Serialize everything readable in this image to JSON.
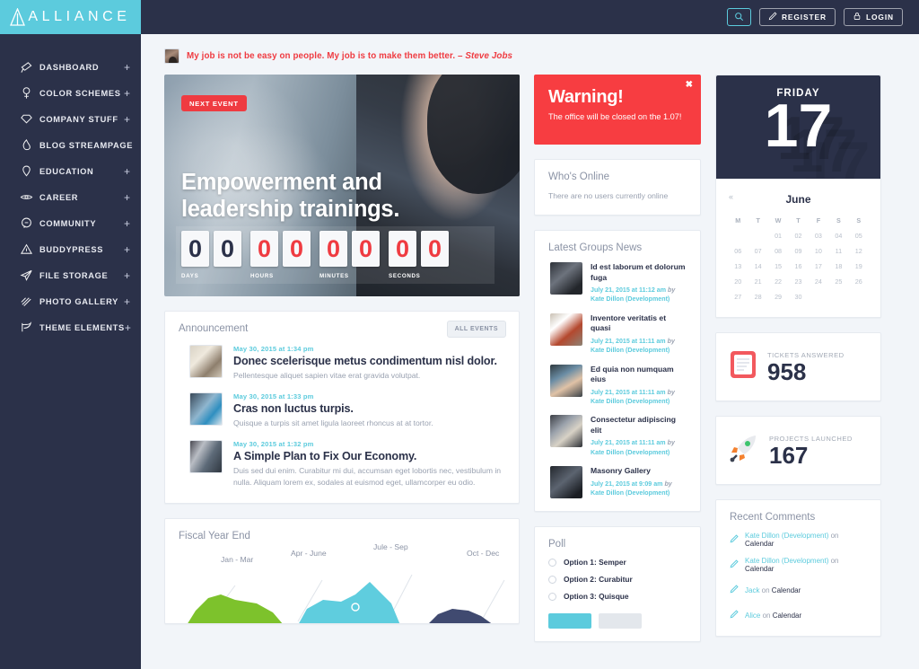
{
  "brand": {
    "name": "ALLIANCE",
    "logo_icon": "triangle-a-icon",
    "accent": "#5ccbdd",
    "dark": "#2b3149",
    "red": "#ef3b41"
  },
  "sidebar": {
    "items": [
      {
        "label": "DASHBOARD",
        "icon": "megaphone-icon",
        "expand": "+"
      },
      {
        "label": "COLOR SCHEMES",
        "icon": "palette-icon",
        "expand": "+"
      },
      {
        "label": "COMPANY STUFF",
        "icon": "diamond-icon",
        "expand": "+"
      },
      {
        "label": "BLOG STREAMPAGE",
        "icon": "flame-icon",
        "expand": ""
      },
      {
        "label": "EDUCATION",
        "icon": "pin-icon",
        "expand": "+"
      },
      {
        "label": "CAREER",
        "icon": "eye-icon",
        "expand": "+"
      },
      {
        "label": "COMMUNITY",
        "icon": "chat-icon",
        "expand": "+"
      },
      {
        "label": "BUDDYPRESS",
        "icon": "triangle-icon",
        "expand": "+"
      },
      {
        "label": "FILE STORAGE",
        "icon": "paper-plane-icon",
        "expand": "+"
      },
      {
        "label": "PHOTO GALLERY",
        "icon": "sparkle-icon",
        "expand": "+"
      },
      {
        "label": "THEME ELEMENTS",
        "icon": "bird-icon",
        "expand": "+"
      }
    ]
  },
  "topbar": {
    "search_icon": "search-icon",
    "register_label": "REGISTER",
    "register_icon": "pencil-icon",
    "login_label": "LOGIN",
    "login_icon": "lock-icon"
  },
  "quote": {
    "text": "My job is not be easy on people. My job is to make them better. – ",
    "author": "Steve Jobs",
    "avatar": "user-avatar"
  },
  "hero": {
    "badge": "NEXT EVENT",
    "title_line1": "Empowerment and",
    "title_line2": "leadership trainings.",
    "countdown": [
      {
        "label": "DAYS",
        "digits": [
          "0",
          "0"
        ],
        "color": "navy"
      },
      {
        "label": "HOURS",
        "digits": [
          "0",
          "0"
        ],
        "color": "red"
      },
      {
        "label": "MINUTES",
        "digits": [
          "0",
          "0"
        ],
        "color": "red"
      },
      {
        "label": "SECONDS",
        "digits": [
          "0",
          "0"
        ],
        "color": "red"
      }
    ]
  },
  "announcement": {
    "title": "Announcement",
    "all_events_label": "ALL EVENTS",
    "items": [
      {
        "date": "May 30, 2015 at 1:34 pm",
        "heading": "Donec scelerisque metus condimentum nisl dolor.",
        "excerpt": "Pellentesque aliquet sapien vitae erat gravida volutpat."
      },
      {
        "date": "May 30, 2015 at 1:33 pm",
        "heading": "Cras non luctus turpis.",
        "excerpt": "Quisque a turpis sit amet ligula laoreet rhoncus at at tortor."
      },
      {
        "date": "May 30, 2015 at 1:32 pm",
        "heading": "A Simple Plan to Fix Our Economy.",
        "excerpt": "Duis sed dui enim. Curabitur mi dui, accumsan eget lobortis nec, vestibulum in nulla. Aliquam lorem ex, sodales at euismod eget, ullamcorper eu odio."
      }
    ]
  },
  "alert": {
    "heading": "Warning!",
    "text": "The office will be closed on the 1.07!",
    "close_icon": "close-icon",
    "color": "#f73d41"
  },
  "whos_online": {
    "title": "Who's Online",
    "empty": "There are no users currently online"
  },
  "groups_news": {
    "title": "Latest Groups News",
    "items": [
      {
        "title": "Id est laborum et dolorum fuga",
        "date": "July 21, 2015 at 11:12 am",
        "by": "by ",
        "author": "Kate Dillon (Development)"
      },
      {
        "title": "Inventore veritatis et quasi",
        "date": "July 21, 2015 at 11:11 am",
        "by": "by ",
        "author": "Kate Dillon (Development)"
      },
      {
        "title": "Ed quia non numquam eius",
        "date": "July 21, 2015 at 11:11 am",
        "by": "by ",
        "author": "Kate Dillon (Development)"
      },
      {
        "title": "Consectetur adipiscing elit",
        "date": "July 21, 2015 at 11:11 am",
        "by": "by ",
        "author": "Kate Dillon (Development)"
      },
      {
        "title": "Masonry Gallery",
        "date": "July 21, 2015 at 9:09 am",
        "by": "by ",
        "author": "Kate Dillon (Development)"
      }
    ]
  },
  "poll": {
    "title": "Poll",
    "options": [
      "Option 1: Semper",
      "Option 2: Curabitur",
      "Option 3: Quisque"
    ],
    "vote_label": "",
    "results_label": ""
  },
  "calendar": {
    "day_name": "FRIDAY",
    "day_number": "17",
    "month": "June",
    "prev_icon": "chevron-left-icon",
    "dow": [
      "M",
      "T",
      "W",
      "T",
      "F",
      "S",
      "S"
    ],
    "blanks_before": 2,
    "days": [
      "01",
      "02",
      "03",
      "04",
      "05",
      "06",
      "07",
      "08",
      "09",
      "10",
      "11",
      "12",
      "13",
      "14",
      "15",
      "16",
      "17",
      "18",
      "19",
      "20",
      "21",
      "22",
      "23",
      "24",
      "25",
      "26",
      "27",
      "28",
      "29",
      "30"
    ]
  },
  "stats": [
    {
      "label": "TICKETS ANSWERED",
      "value": "958",
      "icon": "notepad-icon"
    },
    {
      "label": "PROJECTS LAUNCHED",
      "value": "167",
      "icon": "rocket-icon"
    }
  ],
  "recent_comments": {
    "title": "Recent Comments",
    "items": [
      {
        "icon": "pencil-icon",
        "author": "Kate Dillon (Development)",
        "on": " on ",
        "target": "Calendar"
      },
      {
        "icon": "pencil-icon",
        "author": "Kate Dillon (Development)",
        "on": " on ",
        "target": "Calendar"
      },
      {
        "icon": "pencil-icon",
        "author": "Jack",
        "on": " on ",
        "target": "Calendar"
      },
      {
        "icon": "pencil-icon",
        "author": "Alice",
        "on": " on ",
        "target": "Calendar"
      }
    ]
  },
  "chart_data": {
    "type": "area",
    "title": "Fiscal Year End",
    "categories": [
      "Jan - Mar",
      "Apr - June",
      "Jule - Sep",
      "Oct - Dec"
    ],
    "values": [
      42,
      58,
      72,
      38
    ],
    "colors": [
      "#7dc22c",
      "#5fcdde",
      "#5fcdde",
      "#404a70"
    ],
    "xlabel": "",
    "ylabel": "",
    "grid": false,
    "legend": "none"
  }
}
